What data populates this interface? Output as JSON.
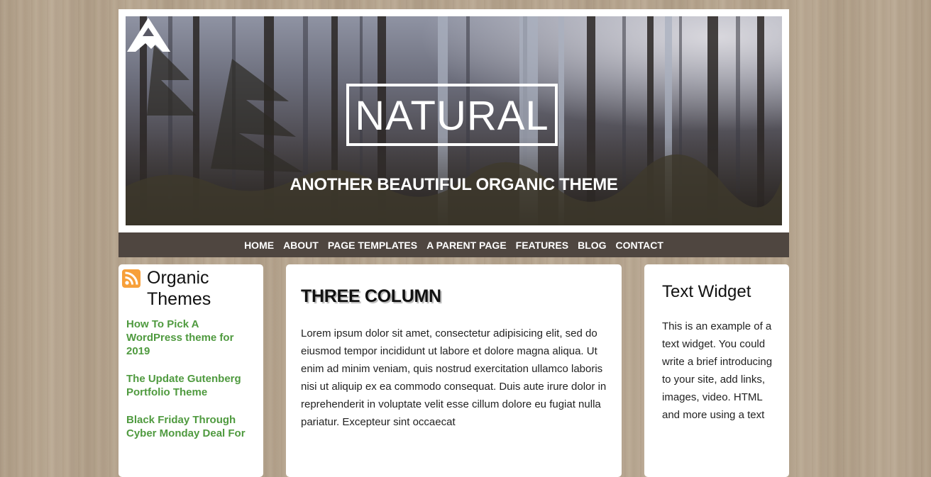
{
  "header": {
    "site_title": "NATURAL",
    "tagline": "ANOTHER BEAUTIFUL ORGANIC THEME"
  },
  "nav": {
    "items": [
      "HOME",
      "ABOUT",
      "PAGE TEMPLATES",
      "A PARENT PAGE",
      "FEATURES",
      "BLOG",
      "CONTACT"
    ]
  },
  "left_widget": {
    "icon": "rss-icon",
    "title": "Organic Themes",
    "links": [
      "How To Pick A WordPress theme for 2019",
      "The Update Gutenberg Portfolio Theme",
      "Black Friday Through Cyber Monday Deal For"
    ]
  },
  "main": {
    "title": "THREE COLUMN",
    "body": "Lorem ipsum dolor sit amet, consectetur adipisicing elit, sed do eiusmod tempor incididunt ut labore et dolore magna aliqua. Ut enim ad minim veniam, quis nostrud exercitation ullamco laboris nisi ut aliquip ex ea commodo consequat. Duis aute irure dolor in reprehenderit in voluptate velit esse cillum dolore eu fugiat nulla pariatur. Excepteur sint occaecat"
  },
  "right_widget": {
    "title": "Text Widget",
    "body": "This is an example of a text widget. You could write a brief introducing to your site, add links, images, video. HTML and more using a text"
  },
  "colors": {
    "nav_bg": "#4f4640",
    "link_green": "#4f9a3f",
    "rss_orange": "#f7a03a"
  }
}
